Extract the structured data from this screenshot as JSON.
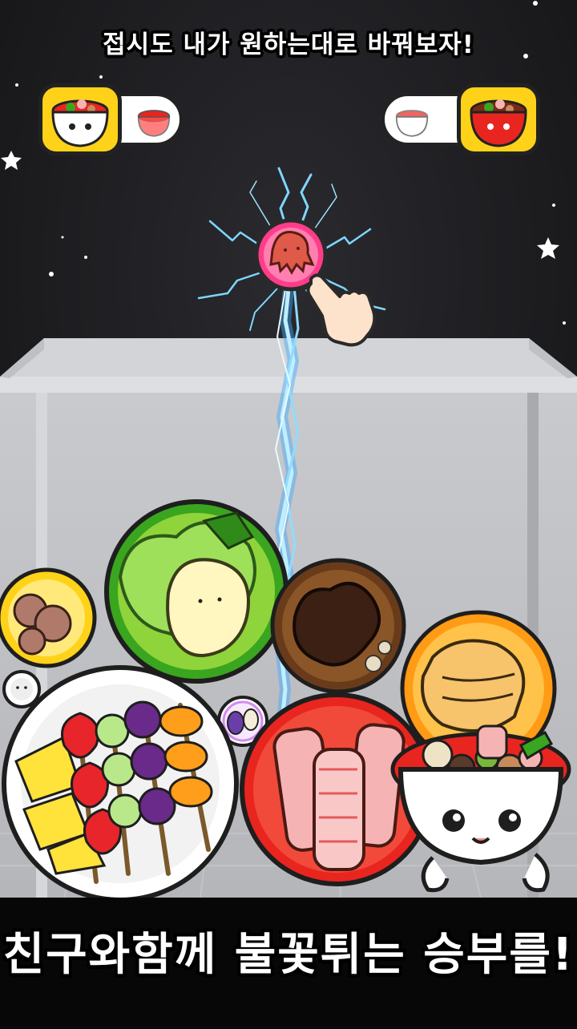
{
  "headline": "접시도 내가 원하는대로 바꿔보자!",
  "footer": "친구와함께 불꽃튀는 승부를!",
  "colors": {
    "background": "#1f1f23",
    "container": "#c7c8cc",
    "toggle_active": "#ffd21a",
    "lightning": "#6fd0ff"
  },
  "skin_toggles": [
    {
      "name": "left",
      "active_position": "left"
    },
    {
      "name": "right",
      "active_position": "right"
    }
  ],
  "foods": [
    {
      "name": "meatballs",
      "color": "#ffd21a"
    },
    {
      "name": "cabbage",
      "color": "#3aa51f"
    },
    {
      "name": "bulgogi",
      "color": "#6a3b1a"
    },
    {
      "name": "fish-cake",
      "color": "#ff9b14"
    },
    {
      "name": "fruit-skewers",
      "color": "#ffffff"
    },
    {
      "name": "beef-rolls",
      "color": "#e8251f"
    },
    {
      "name": "bean",
      "color": "#ffffff"
    },
    {
      "name": "egg",
      "color": "#ffffff"
    },
    {
      "name": "octopus-sausage",
      "color": "#ff3d8b"
    }
  ],
  "mascot": "hotpot-bowl"
}
